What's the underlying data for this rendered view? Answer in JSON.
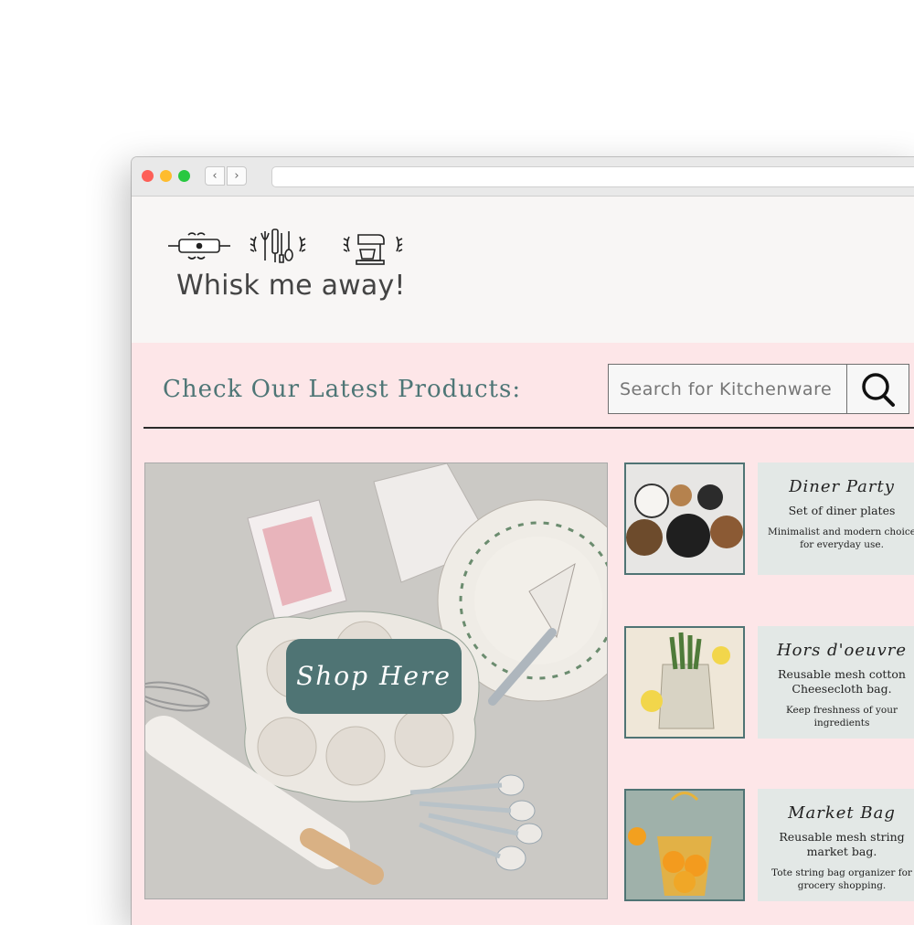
{
  "site": {
    "title": "Whisk me away!",
    "logo_icons": [
      "rolling-pin-icon",
      "utensils-icon",
      "stand-mixer-icon"
    ]
  },
  "main": {
    "heading": "Check Our Latest Products:",
    "search": {
      "placeholder": "Search for Kitchenware",
      "icon": "search-icon"
    },
    "hero": {
      "button_label": "Shop Here"
    }
  },
  "products": [
    {
      "name": "Diner Party",
      "description": "Set of diner plates",
      "subtext": "Minimalist and modern choice for everyday use."
    },
    {
      "name": "Hors d'oeuvre",
      "description": "Reusable mesh cotton Cheesecloth bag.",
      "subtext": "Keep freshness of your ingredients"
    },
    {
      "name": "Market Bag",
      "description": "Reusable mesh string market bag.",
      "subtext": "Tote string bag organizer for grocery shopping."
    }
  ],
  "colors": {
    "accent": "#4f7474",
    "header_bg": "#f8f6f5",
    "pink_bg": "#fde6e8",
    "card_bg": "#e3e8e6"
  }
}
